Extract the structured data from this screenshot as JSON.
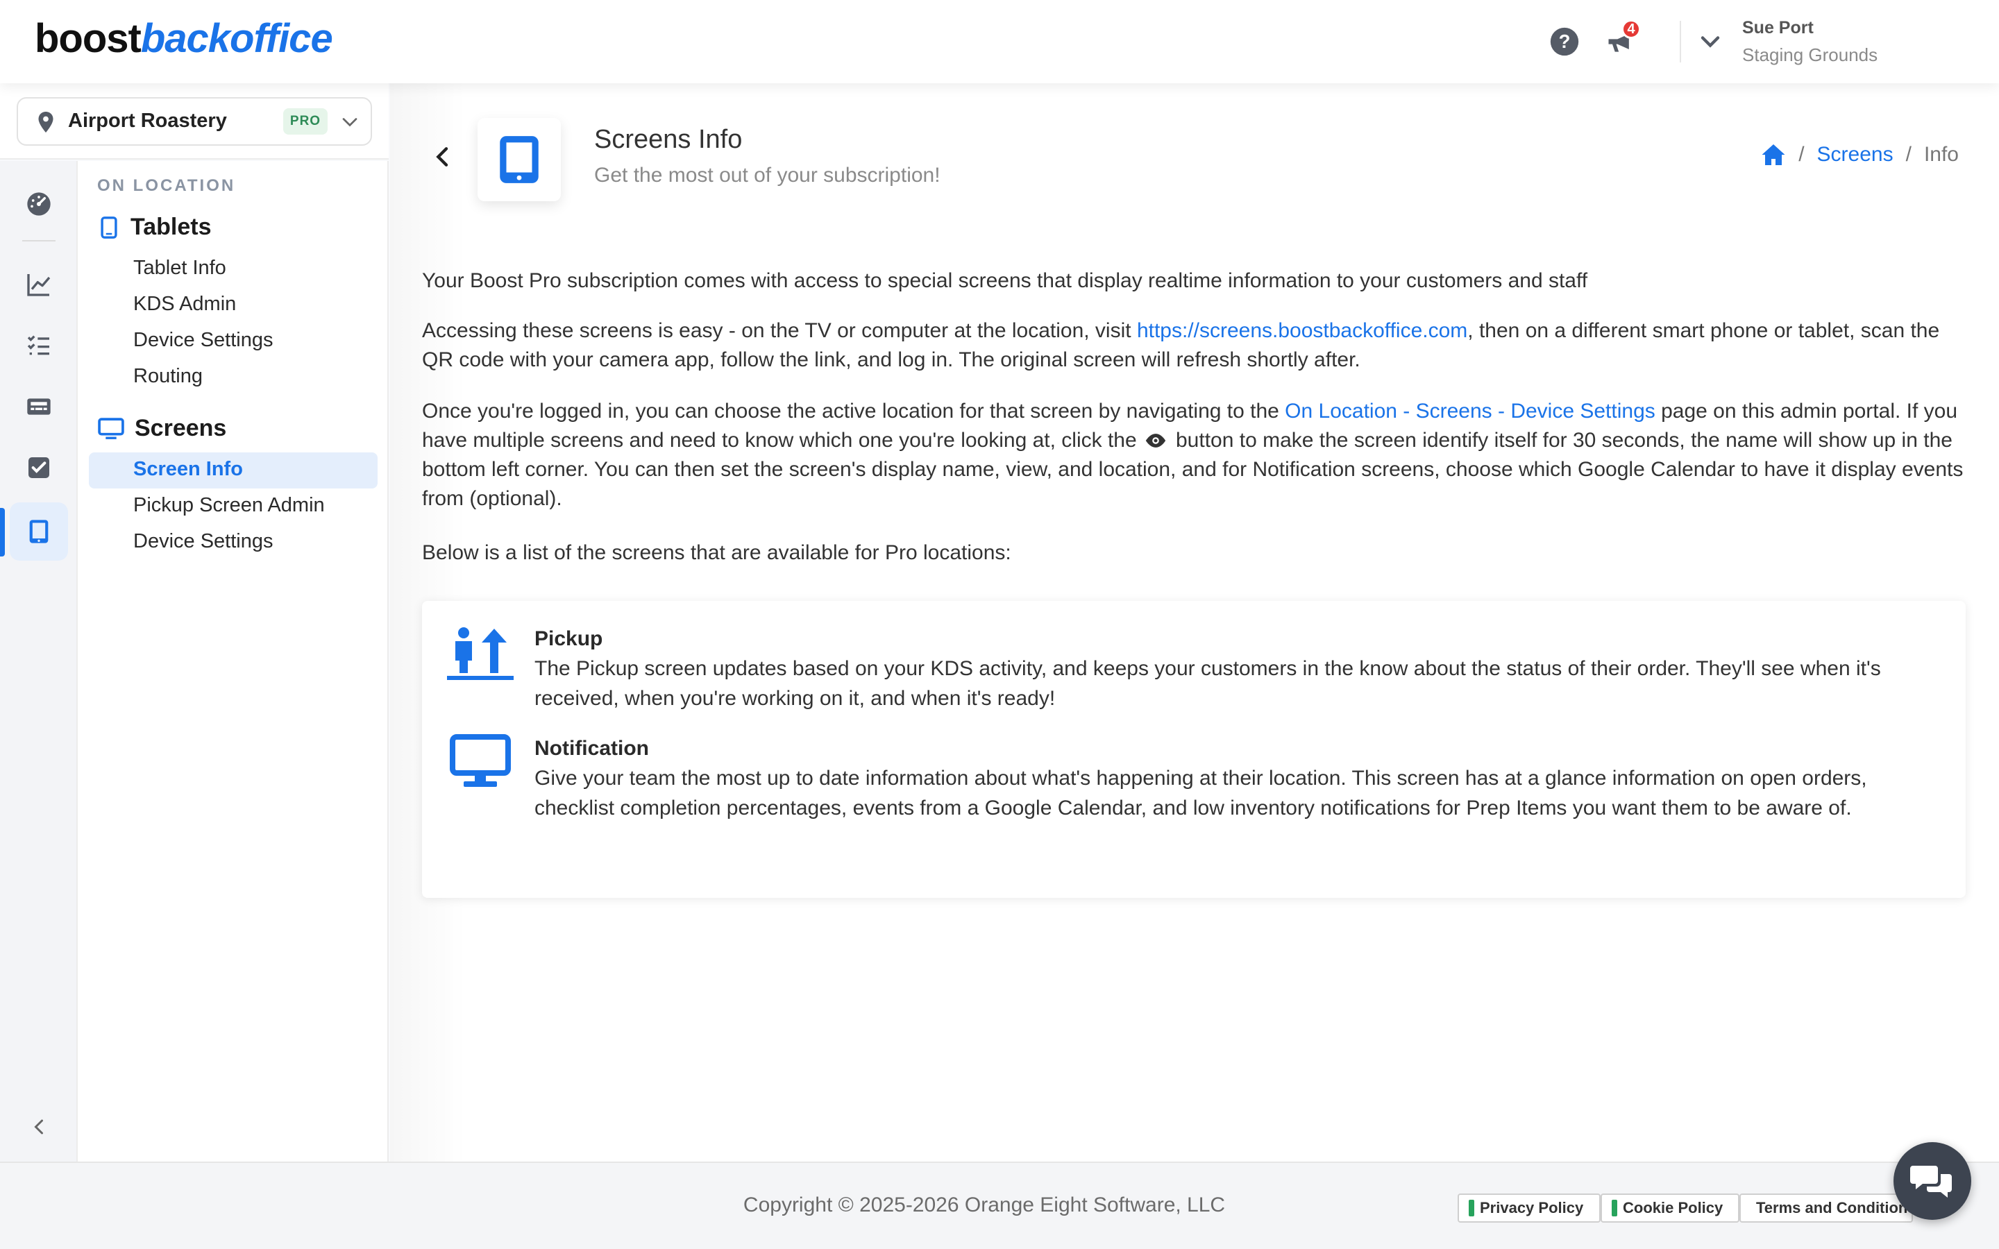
{
  "header": {
    "logo_part1": "boost",
    "logo_part2": "backoffice",
    "notification_count": "4",
    "user_name": "Sue Port",
    "user_org": "Staging Grounds"
  },
  "location": {
    "name": "Airport Roastery",
    "badge": "PRO"
  },
  "rail": {
    "icons": [
      "dashboard-icon",
      "chart-icon",
      "checklist-icon",
      "keyboard-icon",
      "checkbox-icon",
      "tablet-icon"
    ],
    "active": "tablet-icon"
  },
  "subnav": {
    "section_label": "ON LOCATION",
    "groups": [
      {
        "title": "Tablets",
        "icon": "tablet-icon",
        "items": [
          "Tablet Info",
          "KDS Admin",
          "Device Settings",
          "Routing"
        ]
      },
      {
        "title": "Screens",
        "icon": "monitor-icon",
        "items": [
          "Screen Info",
          "Pickup Screen Admin",
          "Device Settings"
        ]
      }
    ],
    "active_item": "Screen Info"
  },
  "page": {
    "title": "Screens Info",
    "subtitle": "Get the most out of your subscription!",
    "breadcrumb": {
      "home_icon": "home-icon",
      "link": "Screens",
      "current": "Info",
      "separator": "/"
    }
  },
  "content": {
    "p1": "Your Boost Pro subscription comes with access to special screens that display realtime information to your customers and staff",
    "p2_before": "Accessing these screens is easy - on the TV or computer at the location, visit ",
    "p2_link": "https://screens.boostbackoffice.com",
    "p2_after": ", then on a different smart phone or tablet, scan the QR code with your camera app, follow the link, and log in. The original screen will refresh shortly after.",
    "p3_before": "Once you're logged in, you can choose the active location for that screen by navigating to the ",
    "p3_link": "On Location - Screens - Device Settings",
    "p3_mid": " page on this admin portal. If you have multiple screens and need to know which one you're looking at, click the",
    "p3_after": " button to make the screen identify itself for 30 seconds, the name will show up in the bottom left corner. You can then set the screen's display name, view, and location, and for Notification screens, choose which Google Calendar to have it display events from (optional).",
    "p4": "Below is a list of the screens that are available for Pro locations:"
  },
  "screens": [
    {
      "icon": "pickup-icon",
      "title": "Pickup",
      "description": "The Pickup screen updates based on your KDS activity, and keeps your customers in the know about the status of their order. They'll see when it's received, when you're working on it, and when it's ready!"
    },
    {
      "icon": "monitor-icon",
      "title": "Notification",
      "description": "Give your team the most up to date information about what's happening at their location. This screen has at a glance information on open orders, checklist completion percentages, events from a Google Calendar, and low inventory notifications for Prep Items you want them to be aware of."
    }
  ],
  "footer": {
    "copyright": "Copyright © 2025-2026 Orange Eight Software, LLC",
    "privacy": "Privacy Policy",
    "cookie": "Cookie Policy",
    "terms": "Terms and Conditions"
  },
  "colors": {
    "accent": "#1a73e8",
    "badge_red": "#e53935",
    "pro_green": "#2e8b57"
  }
}
